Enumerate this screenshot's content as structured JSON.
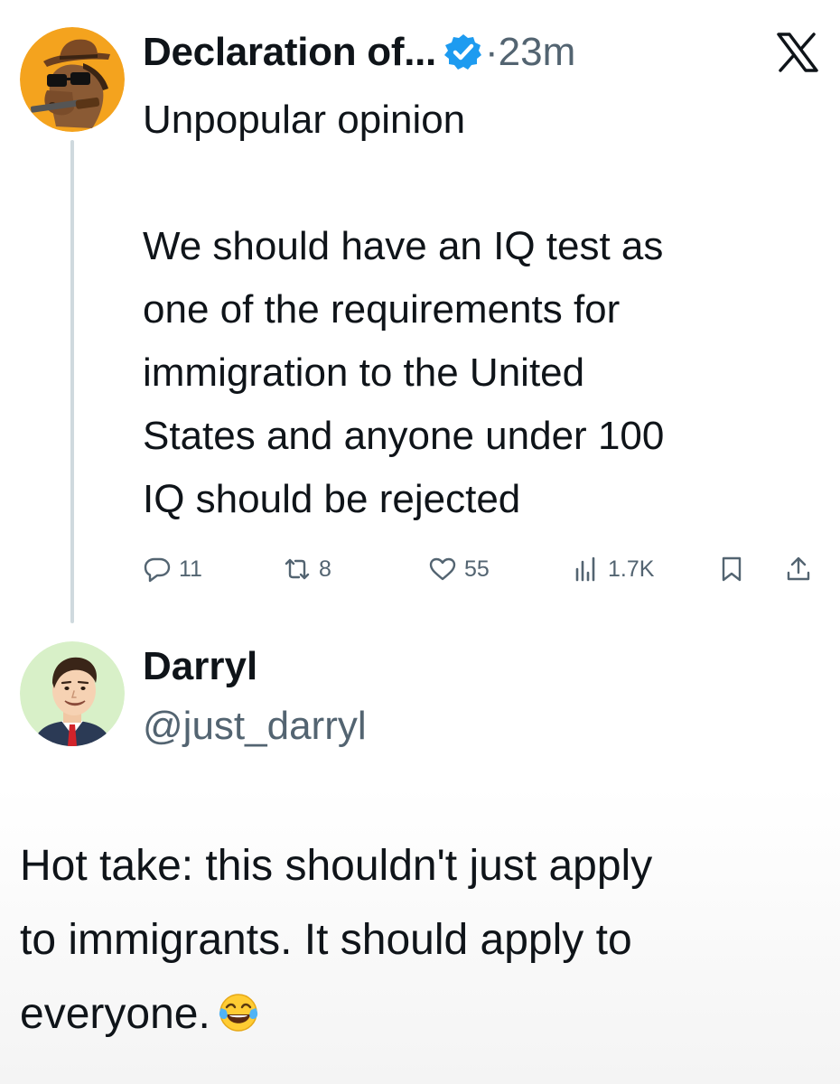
{
  "original_post": {
    "display_name": "Declaration of...",
    "separator": "·",
    "timestamp": "23m",
    "text": "Unpopular opinion\n\nWe should have an IQ test as\none of the requirements for\nimmigration to the United\nStates and anyone under 100\nIQ should be rejected",
    "metrics": {
      "replies": "11",
      "reposts": "8",
      "likes": "55",
      "views": "1.7K"
    },
    "icons": {
      "verified": "verified-badge-icon",
      "platform": "x-logo-icon",
      "reply": "reply-bubble-icon",
      "repost": "repost-icon",
      "like": "heart-icon",
      "views": "bar-chart-icon",
      "bookmark": "bookmark-icon",
      "share": "share-upload-icon"
    }
  },
  "reply_post": {
    "display_name": "Darryl",
    "handle": "@just_darryl",
    "text": "Hot take: this shouldn't just apply\nto immigrants. It should apply to\neveryone.",
    "emoji": "face-with-tears-of-joy"
  },
  "colors": {
    "text_primary": "#0f1419",
    "text_secondary": "#536471",
    "verified_blue": "#1d9bf0",
    "thread_line": "#cfd9de"
  }
}
